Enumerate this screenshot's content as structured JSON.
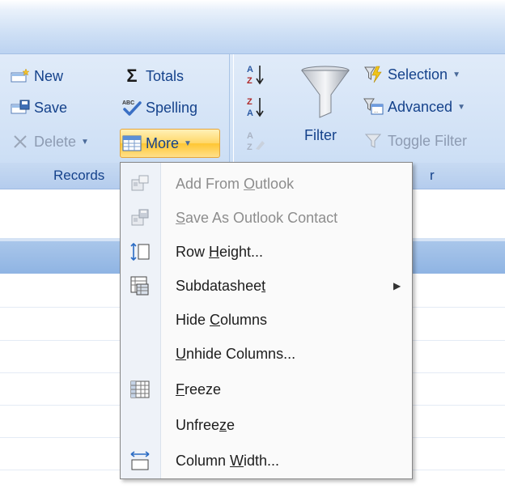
{
  "ribbon": {
    "records": {
      "new": {
        "label": "New",
        "icon": "new-record-icon"
      },
      "save": {
        "label": "Save",
        "icon": "save-icon"
      },
      "delete": {
        "label": "Delete",
        "icon": "delete-x-icon",
        "enabled": false
      },
      "totals": {
        "label": "Totals",
        "icon": "sigma-icon"
      },
      "spelling": {
        "label": "Spelling",
        "icon": "spelling-check-icon"
      },
      "more": {
        "label": "More",
        "icon": "datasheet-grid-icon",
        "state": "open"
      },
      "group_label": "Records"
    },
    "sort_filter": {
      "sort_ascending_icon": "sort-az-icon",
      "sort_descending_icon": "sort-za-icon",
      "clear_sort_icon": "clear-sort-icon",
      "filter": {
        "label": "Filter",
        "icon": "funnel-icon"
      },
      "selection": {
        "label": "Selection",
        "icon": "selection-filter-icon"
      },
      "advanced": {
        "label": "Advanced",
        "icon": "advanced-filter-icon"
      },
      "toggle_filter": {
        "label": "Toggle Filter",
        "icon": "toggle-filter-icon",
        "enabled": false
      },
      "group_label_visible": "r"
    }
  },
  "menu": {
    "items": [
      {
        "pre": "Add From ",
        "key": "O",
        "post": "utlook",
        "icon": "outlook-add-contact-icon",
        "enabled": false,
        "submenu": false
      },
      {
        "pre": "",
        "key": "S",
        "post": "ave As Outlook Contact",
        "icon": "outlook-save-contact-icon",
        "enabled": false,
        "submenu": false
      },
      {
        "pre": "Row ",
        "key": "H",
        "post": "eight...",
        "icon": "row-height-icon",
        "enabled": true,
        "submenu": false
      },
      {
        "pre": "Subdatashee",
        "key": "t",
        "post": "",
        "icon": "subdatasheet-icon",
        "enabled": true,
        "submenu": true
      },
      {
        "pre": "Hide ",
        "key": "C",
        "post": "olumns",
        "icon": "",
        "enabled": true,
        "submenu": false
      },
      {
        "pre": "",
        "key": "U",
        "post": "nhide Columns...",
        "icon": "",
        "enabled": true,
        "submenu": false
      },
      {
        "pre": "",
        "key": "F",
        "post": "reeze",
        "icon": "freeze-grid-icon",
        "enabled": true,
        "submenu": false
      },
      {
        "pre": "Unfree",
        "key": "z",
        "post": "e",
        "icon": "",
        "enabled": true,
        "submenu": false
      },
      {
        "pre": "Column ",
        "key": "W",
        "post": "idth...",
        "icon": "column-width-icon",
        "enabled": true,
        "submenu": false
      }
    ]
  },
  "colors": {
    "ribbon_text": "#15428b",
    "highlight_border": "#e5a53c",
    "highlight_fill": "#ffd767",
    "menu_text": "#1d1d1d",
    "disabled_text": "#8d8d8d"
  }
}
